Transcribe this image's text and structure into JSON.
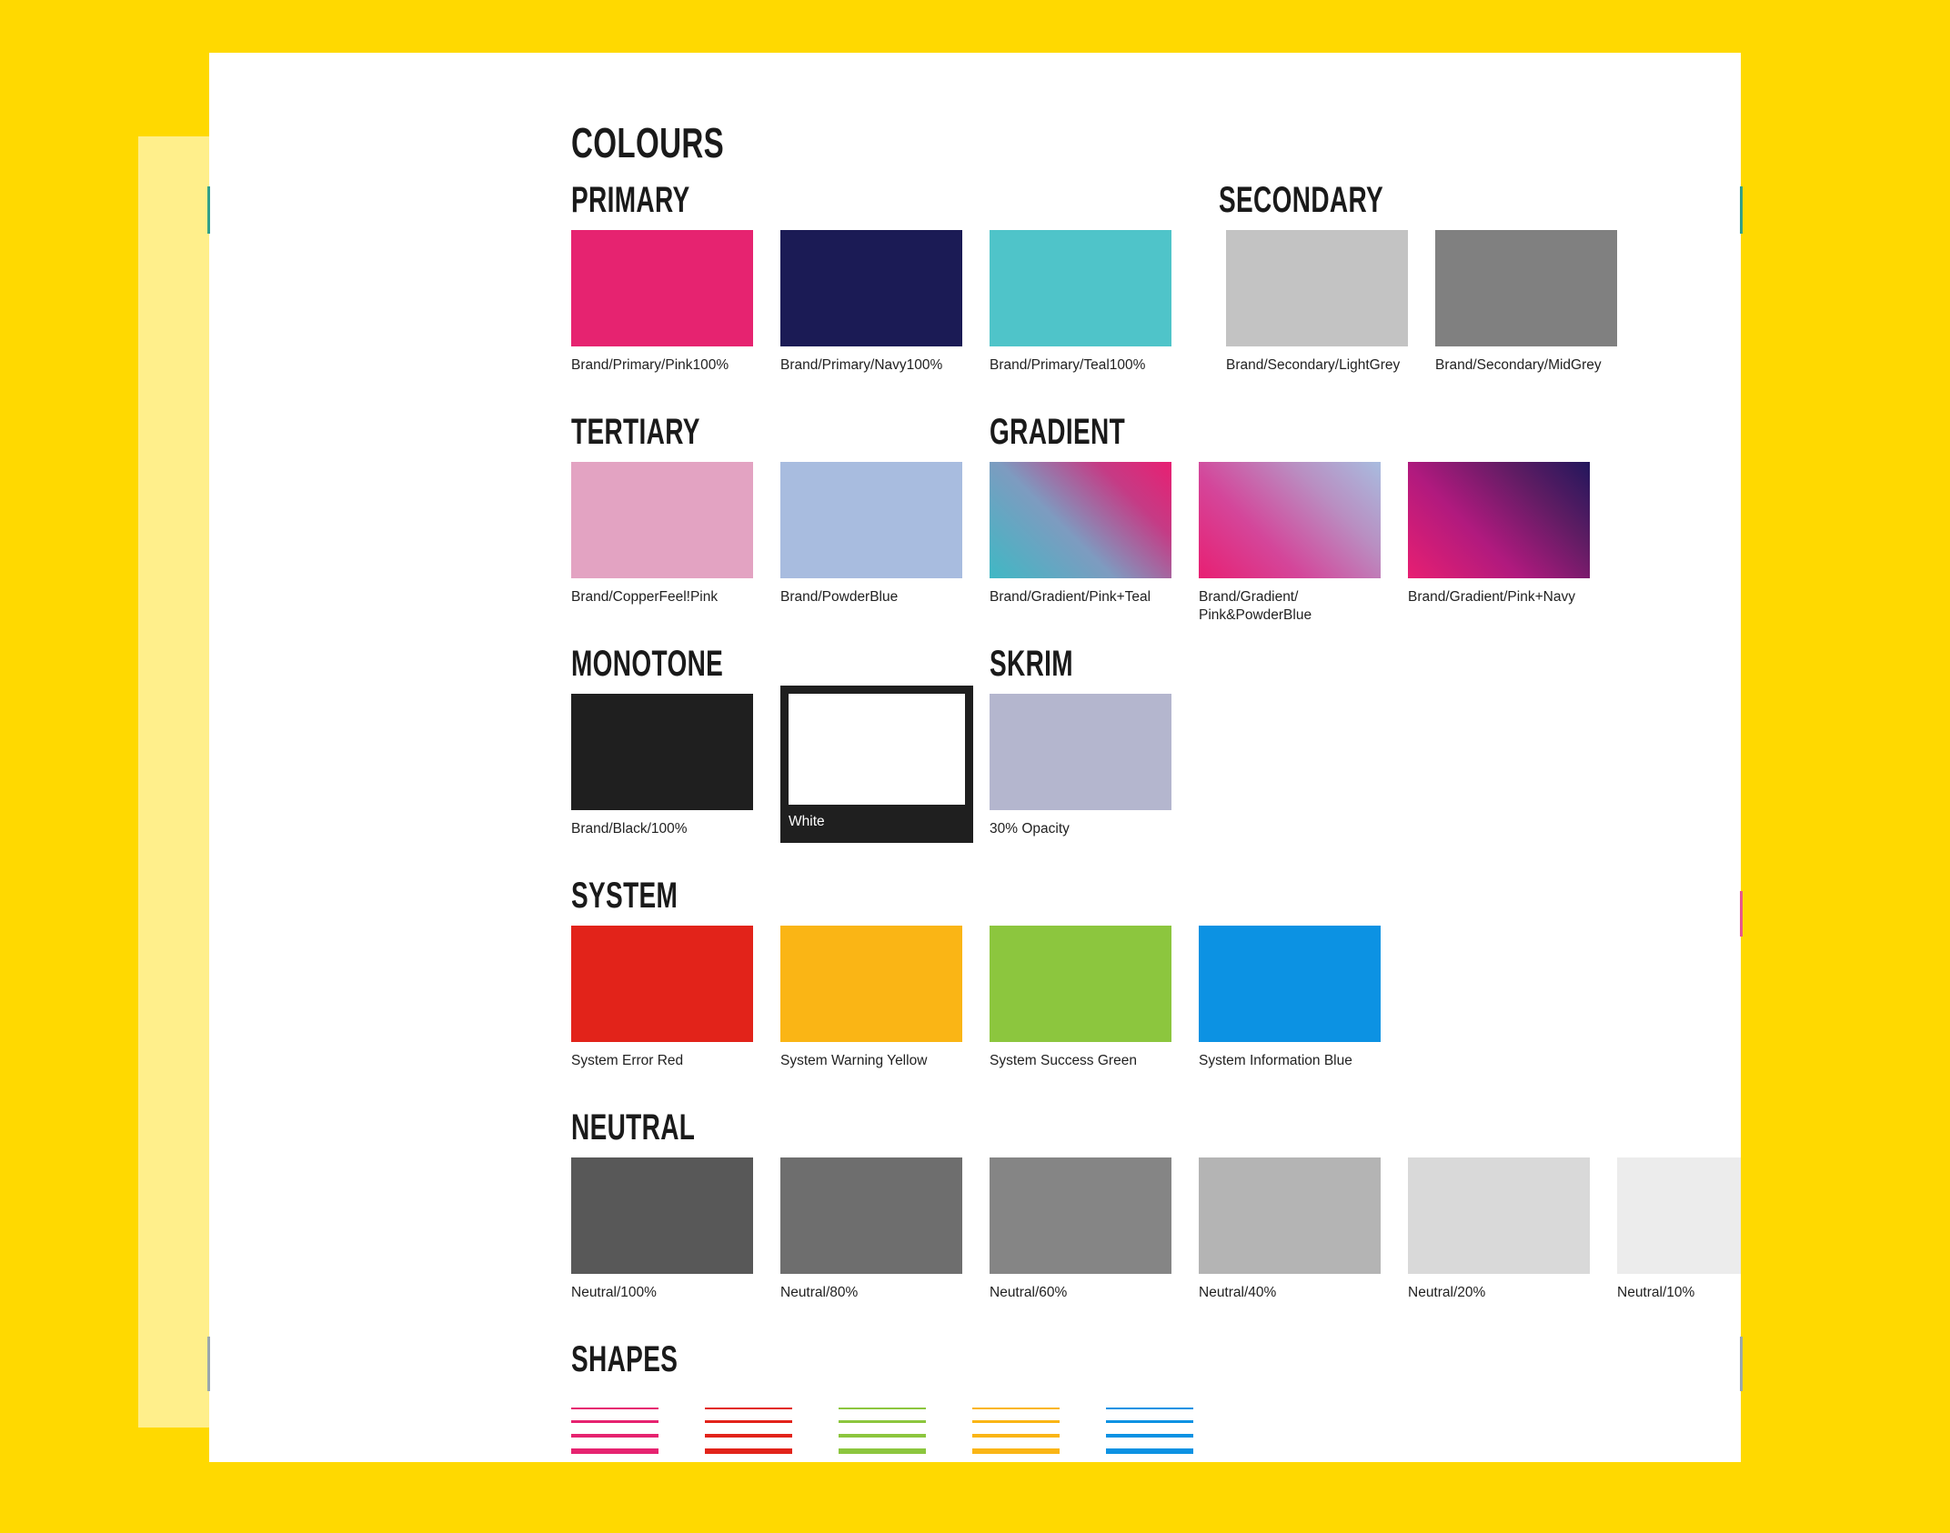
{
  "background": {
    "outer_color": "#FFD900",
    "pale_panel_color": "#FFEF8B",
    "card_color": "#FFFFFF"
  },
  "page": {
    "title": "COLOURS"
  },
  "sections": {
    "primary": {
      "heading": "PRIMARY",
      "swatches": [
        {
          "label": "Brand/Primary/Pink100%",
          "color": "#E62370"
        },
        {
          "label": "Brand/Primary/Navy100%",
          "color": "#1B1B55"
        },
        {
          "label": "Brand/Primary/Teal100%",
          "color": "#4FC4C9"
        }
      ]
    },
    "secondary": {
      "heading": "SECONDARY",
      "swatches": [
        {
          "label": "Brand/Secondary/LightGrey",
          "color": "#C3C3C3"
        },
        {
          "label": "Brand/Secondary/MidGrey",
          "color": "#808080"
        }
      ]
    },
    "tertiary": {
      "heading": "TERTIARY",
      "swatches": [
        {
          "label": "Brand/CopperFeel!Pink",
          "color": "#E3A3C2"
        },
        {
          "label": "Brand/PowderBlue",
          "color": "#A8BCDF"
        }
      ]
    },
    "gradient": {
      "heading": "GRADIENT",
      "swatches": [
        {
          "label": "Brand/Gradient/Pink+Teal",
          "gradient": "linear-gradient(45deg, #3FB8C4 0%, #7E9BC0 42%, #C53B85 75%, #E81F72 100%)"
        },
        {
          "label": "Brand/Gradient/\nPink&PowderBlue",
          "gradient": "linear-gradient(45deg, #E81F72 0%, #D4469A 35%, #B98FC2 70%, #A8BCDF 100%)"
        },
        {
          "label": "Brand/Gradient/Pink+Navy",
          "gradient": "linear-gradient(45deg, #E81F72 0%, #B01A7E 38%, #5E1C63 72%, #22175C 100%)"
        }
      ]
    },
    "monotone": {
      "heading": "MONOTONE",
      "swatches": [
        {
          "label": "Brand/Black/100%",
          "color": "#1F1F1F"
        },
        {
          "label": "White",
          "color": "#FFFFFF",
          "card_color": "#1F1F1F",
          "on_dark": true
        }
      ]
    },
    "skrim": {
      "heading": "SKRIM",
      "swatches": [
        {
          "label": "30% Opacity",
          "color": "#B4B6CE"
        }
      ]
    },
    "system": {
      "heading": "SYSTEM",
      "swatches": [
        {
          "label": "System Error Red",
          "color": "#E2231A"
        },
        {
          "label": "System Warning Yellow",
          "color": "#FAB515"
        },
        {
          "label": "System Success Green",
          "color": "#8CC63E"
        },
        {
          "label": "System Information Blue",
          "color": "#0C92E3"
        }
      ]
    },
    "neutral": {
      "heading": "NEUTRAL",
      "swatches": [
        {
          "label": "Neutral/100%",
          "color": "#585858"
        },
        {
          "label": "Neutral/80%",
          "color": "#6E6E6E"
        },
        {
          "label": "Neutral/60%",
          "color": "#858585"
        },
        {
          "label": "Neutral/40%",
          "color": "#B4B4B4"
        },
        {
          "label": "Neutral/20%",
          "color": "#D9D9D9"
        },
        {
          "label": "Neutral/10%",
          "color": "#ECECEC"
        }
      ]
    },
    "shapes": {
      "heading": "SHAPES",
      "columns": [
        {
          "name": "pink",
          "color": "#E62370"
        },
        {
          "name": "red",
          "color": "#E2231A"
        },
        {
          "name": "green",
          "color": "#8CC63E"
        },
        {
          "name": "yellow",
          "color": "#FAB515"
        },
        {
          "name": "blue",
          "color": "#0C92E3"
        }
      ],
      "line_weights": [
        2,
        3,
        4,
        6
      ],
      "box_weights": [
        2,
        4
      ]
    }
  }
}
